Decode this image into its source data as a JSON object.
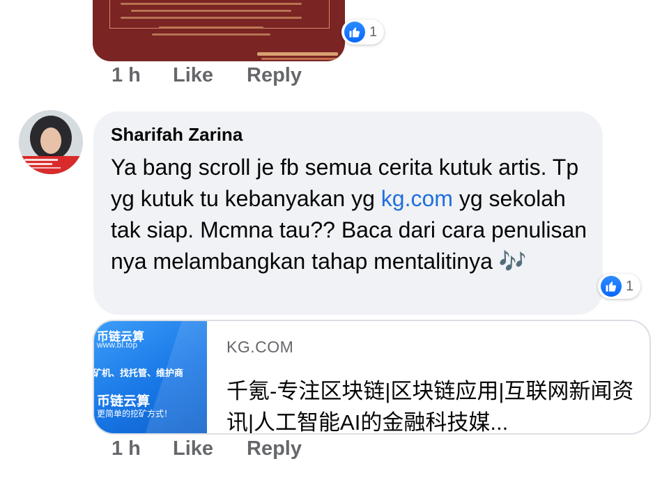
{
  "top_comment": {
    "reaction_icon": "like-icon",
    "reaction_count": "1",
    "time": "1 h",
    "like_label": "Like",
    "reply_label": "Reply"
  },
  "comment": {
    "author": "Sharifah Zarina",
    "text_part1": "Ya bang scroll je fb semua cerita kutuk artis. Tp yg kutuk tu kebanyakan yg ",
    "link_text": "kg.com",
    "text_part2": " yg sekolah tak siap. Mcmna tau?? Baca dari cara penulisan nya melambangkan tahap mentalitinya ",
    "emoji": "🎶",
    "reaction_icon": "like-icon",
    "reaction_count": "1",
    "link_preview": {
      "domain": "KG.COM",
      "title": "千氪-专注区块链|区块链应用|互联网新闻资讯|人工智能AI的金融科技媒...",
      "thumbnail_text": {
        "brand": "币链云算",
        "url": "www.bl.top",
        "slogan": "矿机、找托管、维护商",
        "brand2": "币链云算",
        "tagline": "更简单的挖矿方式！"
      }
    },
    "time": "1 h",
    "like_label": "Like",
    "reply_label": "Reply"
  },
  "colors": {
    "like_blue": "#0866ff",
    "link_blue": "#216fdb",
    "bubble_bg": "#f0f2f5",
    "meta_gray": "#65676b"
  }
}
